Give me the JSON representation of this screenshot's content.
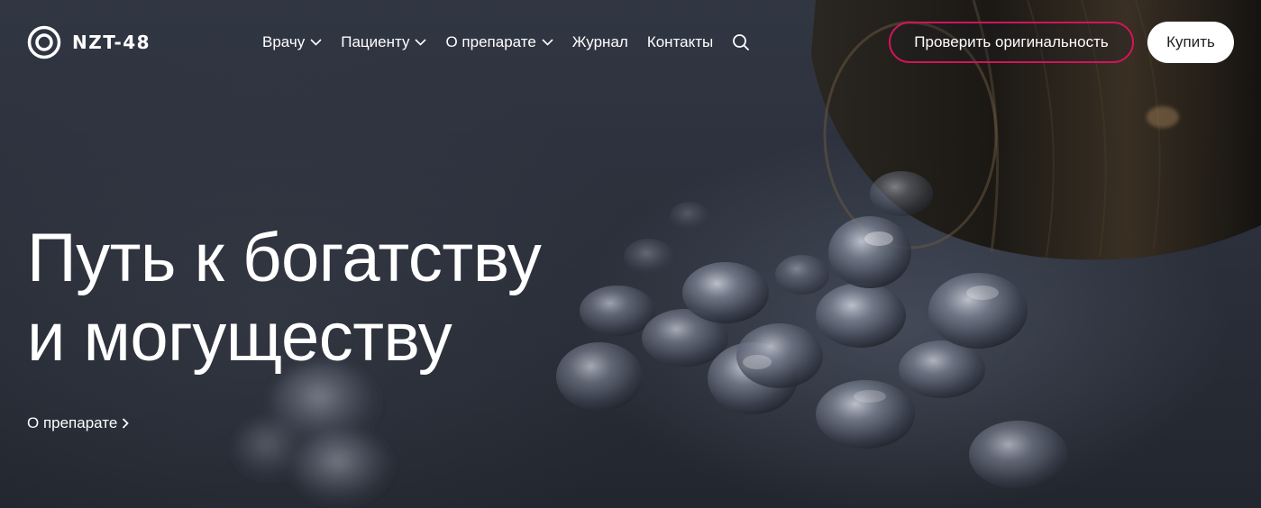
{
  "brand": {
    "name": "NZT-48",
    "logo_icon": "concentric-circle-logo"
  },
  "nav": {
    "items": [
      {
        "label": "Врачу",
        "has_dropdown": true
      },
      {
        "label": "Пациенту",
        "has_dropdown": true
      },
      {
        "label": "О препарате",
        "has_dropdown": true
      },
      {
        "label": "Журнал",
        "has_dropdown": false
      },
      {
        "label": "Контакты",
        "has_dropdown": false
      }
    ],
    "search_icon": "search-icon"
  },
  "actions": {
    "verify_label": "Проверить оригинальность",
    "buy_label": "Купить"
  },
  "hero": {
    "title_line1": "Путь к богатству",
    "title_line2": "и могуществу",
    "link_label": "О препарате"
  },
  "colors": {
    "accent": "#d1145a",
    "background": "#2b303b",
    "text": "#ffffff"
  }
}
